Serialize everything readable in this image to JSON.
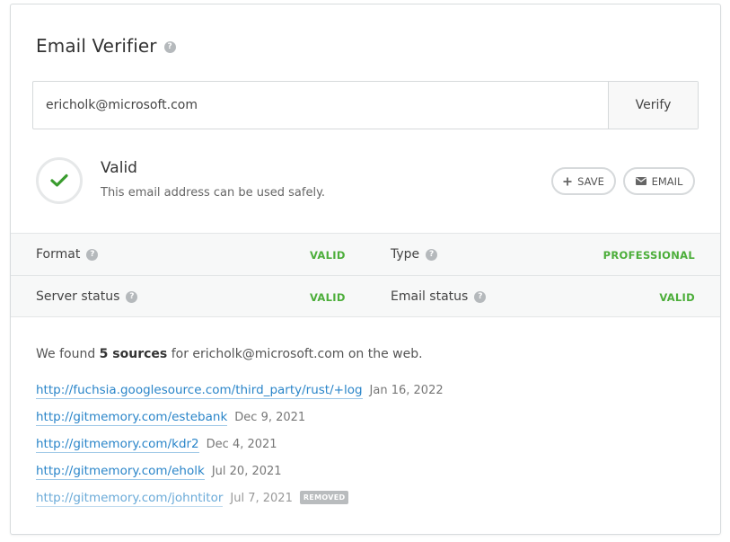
{
  "header": {
    "title": "Email Verifier",
    "help_icon": "question-icon"
  },
  "verify": {
    "input_value": "ericholk@microsoft.com",
    "button_label": "Verify"
  },
  "result": {
    "status_title": "Valid",
    "description": "This email address can be used safely.",
    "icon": "check-icon",
    "icon_color": "#3a9c2e",
    "save_label": "SAVE",
    "email_label": "EMAIL"
  },
  "attributes": [
    {
      "label": "Format",
      "value": "VALID"
    },
    {
      "label": "Type",
      "value": "PROFESSIONAL"
    },
    {
      "label": "Server status",
      "value": "VALID"
    },
    {
      "label": "Email status",
      "value": "VALID"
    }
  ],
  "sources": {
    "intro_prefix": "We found",
    "count_text": "5 sources",
    "intro_suffix": "for ericholk@microsoft.com on the web.",
    "items": [
      {
        "url": "http://fuchsia.googlesource.com/third_party/rust/+log",
        "date": "Jan 16, 2022"
      },
      {
        "url": "http://gitmemory.com/estebank",
        "date": "Dec 9, 2021"
      },
      {
        "url": "http://gitmemory.com/kdr2",
        "date": "Dec 4, 2021"
      },
      {
        "url": "http://gitmemory.com/eholk",
        "date": "Jul 20, 2021"
      },
      {
        "url": "http://gitmemory.com/johntitor",
        "date": "Jul 7, 2021",
        "badge": "REMOVED"
      }
    ]
  },
  "colors": {
    "accent_green": "#4cae3a",
    "link_blue": "#2a85c9"
  }
}
